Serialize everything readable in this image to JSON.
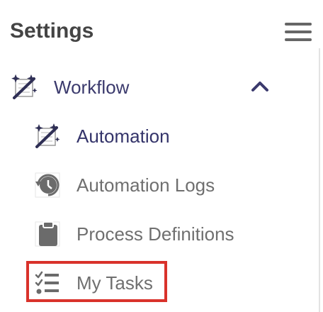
{
  "header": {
    "title": "Settings",
    "menu_icon": "hamburger-menu-icon"
  },
  "nav": {
    "items": [
      {
        "label": "Workflow",
        "icon": "workflow-wand-icon",
        "expanded": true,
        "children": [
          {
            "label": "Automation",
            "icon": "automation-wand-icon",
            "active": true
          },
          {
            "label": "Automation Logs",
            "icon": "history-icon"
          },
          {
            "label": "Process Definitions",
            "icon": "clipboard-icon"
          },
          {
            "label": "My Tasks",
            "icon": "task-list-icon",
            "highlighted": true
          }
        ]
      }
    ]
  },
  "colors": {
    "active_text": "#34346a",
    "inactive_text": "#6f6f6f",
    "highlight_border": "#d9322b",
    "title_text": "#444444"
  }
}
